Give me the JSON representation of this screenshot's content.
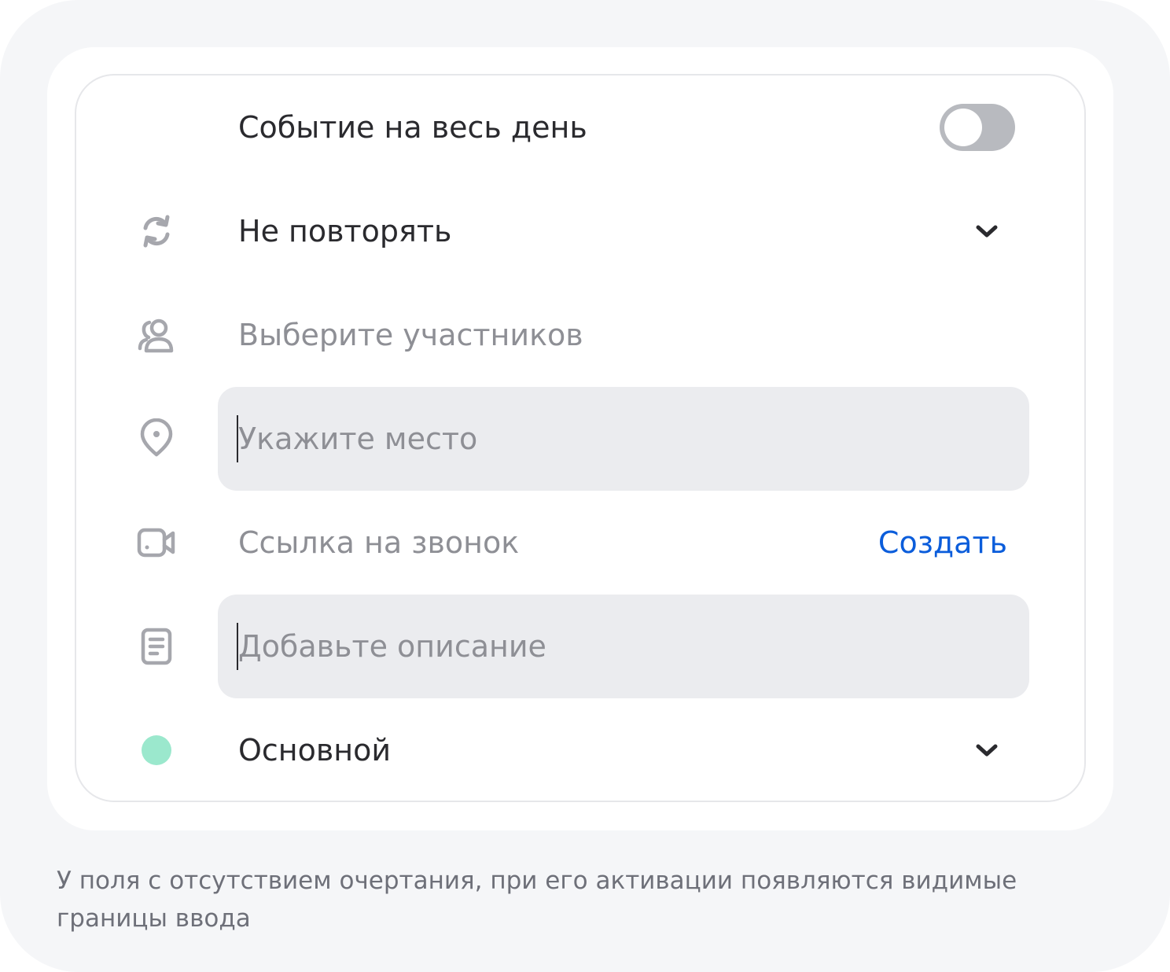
{
  "form": {
    "all_day": {
      "label": "Событие на весь день",
      "enabled": false
    },
    "repeat": {
      "icon": "repeat-icon",
      "value": "Не повторять",
      "chevron": "chevron-down-icon"
    },
    "participants": {
      "icon": "people-icon",
      "placeholder": "Выберите участников"
    },
    "location": {
      "icon": "location-pin-icon",
      "placeholder": "Укажите место"
    },
    "call_link": {
      "icon": "video-camera-icon",
      "placeholder": "Ссылка на звонок",
      "action_label": "Создать"
    },
    "description": {
      "icon": "document-icon",
      "placeholder": "Добавьте описание"
    },
    "calendar": {
      "value": "Основной",
      "color": "#9be8cd",
      "chevron": "chevron-down-icon"
    }
  },
  "caption": "У поля с отсутствием очертания, при его активации появляются видимые границы ввода",
  "colors": {
    "accent_link": "#0b5ddb",
    "toggle_off": "#b8babf",
    "input_bg": "#ebecef",
    "icon_gray": "#a6a7ad"
  }
}
